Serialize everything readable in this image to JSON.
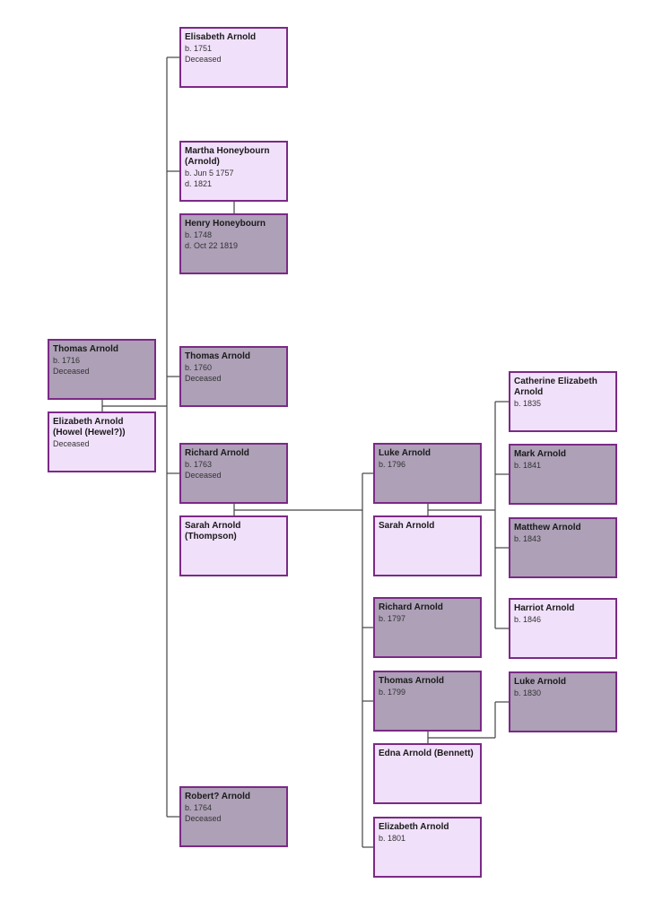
{
  "colors": {
    "male_fill": "#ada0b7",
    "female_fill": "#f1e0fa",
    "border": "#7b2a86"
  },
  "people": [
    {
      "name": "Thomas Arnold",
      "lines": [
        "b.   1716",
        "Deceased"
      ],
      "style": "dark"
    },
    {
      "name": "Elizabeth Arnold (Howel (Hewel?))",
      "lines": [
        "Deceased"
      ],
      "style": "light"
    },
    {
      "name": "Elisabeth Arnold",
      "lines": [
        "b.   1751",
        "Deceased"
      ],
      "style": "light"
    },
    {
      "name": "Martha Honeybourn (Arnold)",
      "lines": [
        "b.   Jun 5 1757",
        "d.   1821"
      ],
      "style": "light"
    },
    {
      "name": "Henry Honeybourn",
      "lines": [
        "b.   1748",
        "d.   Oct 22 1819"
      ],
      "style": "dark"
    },
    {
      "name": "Thomas Arnold",
      "lines": [
        "b.   1760",
        "Deceased"
      ],
      "style": "dark"
    },
    {
      "name": "Richard Arnold",
      "lines": [
        "b.   1763",
        "Deceased"
      ],
      "style": "dark"
    },
    {
      "name": "Sarah Arnold (Thompson)",
      "lines": [],
      "style": "light"
    },
    {
      "name": "Robert? Arnold",
      "lines": [
        "b.   1764",
        "Deceased"
      ],
      "style": "dark"
    },
    {
      "name": "Luke Arnold",
      "lines": [
        "b.   1796"
      ],
      "style": "dark"
    },
    {
      "name": "Sarah Arnold",
      "lines": [],
      "style": "light"
    },
    {
      "name": "Richard Arnold",
      "lines": [
        "b.   1797"
      ],
      "style": "dark"
    },
    {
      "name": "Thomas Arnold",
      "lines": [
        "b.   1799"
      ],
      "style": "dark"
    },
    {
      "name": "Edna Arnold (Bennett)",
      "lines": [],
      "style": "light"
    },
    {
      "name": "Elizabeth Arnold",
      "lines": [
        "b.   1801"
      ],
      "style": "light"
    },
    {
      "name": "Catherine Elizabeth Arnold",
      "lines": [
        "b.   1835"
      ],
      "style": "light"
    },
    {
      "name": "Mark Arnold",
      "lines": [
        "b.   1841"
      ],
      "style": "dark"
    },
    {
      "name": "Matthew Arnold",
      "lines": [
        "b.   1843"
      ],
      "style": "dark"
    },
    {
      "name": "Harriot Arnold",
      "lines": [
        "b.   1846"
      ],
      "style": "light"
    },
    {
      "name": "Luke Arnold",
      "lines": [
        "b.   1830"
      ],
      "style": "dark"
    }
  ]
}
